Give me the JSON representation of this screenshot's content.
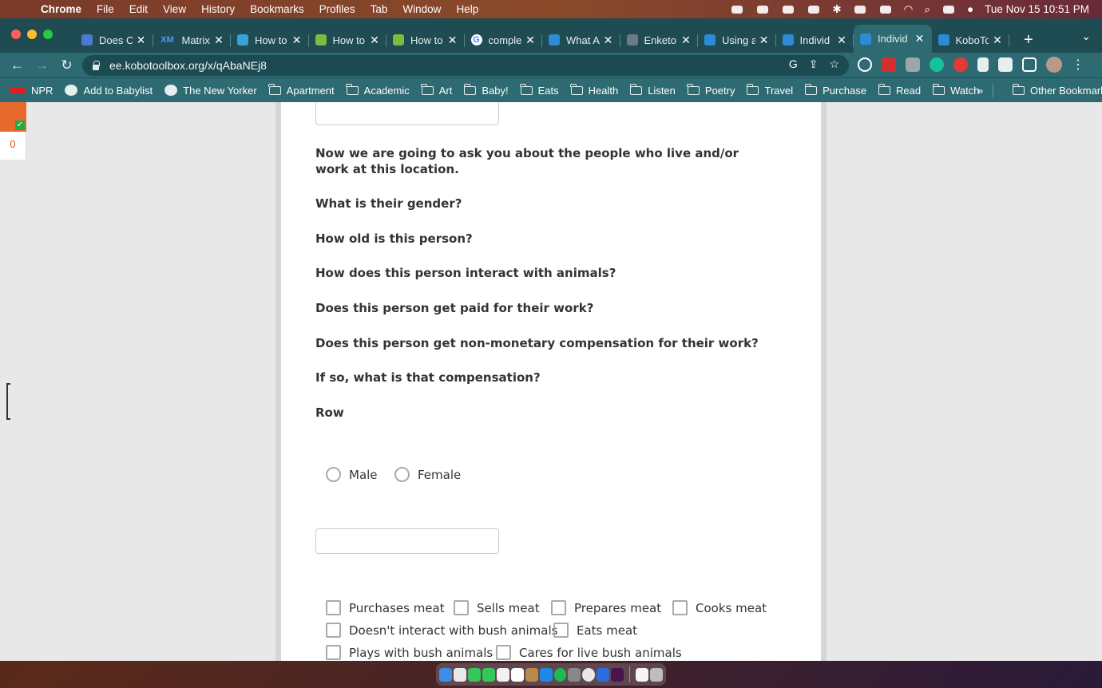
{
  "menubar": {
    "app_name": "Chrome",
    "items": [
      "File",
      "Edit",
      "View",
      "History",
      "Bookmarks",
      "Profiles",
      "Tab",
      "Window",
      "Help"
    ],
    "clock": "Tue Nov 15  10:51 PM"
  },
  "tabs": [
    {
      "title": "Does C",
      "favicon_color": "#4a7bd0"
    },
    {
      "title": "Matrix",
      "favicon_color": "#3b82f6",
      "favicon_text": "XM"
    },
    {
      "title": "How to",
      "favicon_color": "#3aa0d8"
    },
    {
      "title": "How to",
      "favicon_color": "#7cbc42"
    },
    {
      "title": "How to",
      "favicon_color": "#7cbc42"
    },
    {
      "title": "comple",
      "favicon_color": "#ffffff",
      "favicon_text": "G"
    },
    {
      "title": "What A",
      "favicon_color": "#2d8bd6"
    },
    {
      "title": "Enketo",
      "favicon_color": "#6c7a89"
    },
    {
      "title": "Using a",
      "favicon_color": "#2d8bd6"
    },
    {
      "title": "Individ",
      "favicon_color": "#2d8bd6"
    },
    {
      "title": "Individ",
      "favicon_color": "#2d8bd6",
      "active": true
    },
    {
      "title": "KoboTo",
      "favicon_color": "#2d8bd6"
    }
  ],
  "address_bar": {
    "url": "ee.kobotoolbox.org/x/qAbaNEj8"
  },
  "bookmarks": [
    {
      "label": "NPR",
      "type": "site"
    },
    {
      "label": "Add to Babylist",
      "type": "site"
    },
    {
      "label": "The New Yorker",
      "type": "site"
    },
    {
      "label": "Apartment",
      "type": "folder"
    },
    {
      "label": "Academic",
      "type": "folder"
    },
    {
      "label": "Art",
      "type": "folder"
    },
    {
      "label": "Baby!",
      "type": "folder"
    },
    {
      "label": "Eats",
      "type": "folder"
    },
    {
      "label": "Health",
      "type": "folder"
    },
    {
      "label": "Listen",
      "type": "folder"
    },
    {
      "label": "Poetry",
      "type": "folder"
    },
    {
      "label": "Travel",
      "type": "folder"
    },
    {
      "label": "Purchase",
      "type": "folder"
    },
    {
      "label": "Read",
      "type": "folder"
    },
    {
      "label": "Watch",
      "type": "folder"
    }
  ],
  "bookmarks_overflow": "»",
  "other_bookmarks": "Other Bookmarks",
  "widget": {
    "count": "0"
  },
  "form": {
    "intro": "Now we are going to ask you about the people who live and/or work at this location.",
    "questions": [
      "What is their gender?",
      "How old is this person?",
      "How does this person interact with animals?",
      "Does this person get paid for their work?",
      "Does this person get non-monetary compensation for their work?",
      "If so, what is that compensation?"
    ],
    "row_label": "Row",
    "gender_options": [
      "Male",
      "Female"
    ],
    "age_value": "",
    "interaction_options": [
      "Purchases meat",
      "Sells meat",
      "Prepares meat",
      "Cooks meat",
      "Doesn't interact with bush animals",
      "Eats meat",
      "Plays with bush animals",
      "Cares for live bush animals"
    ]
  }
}
